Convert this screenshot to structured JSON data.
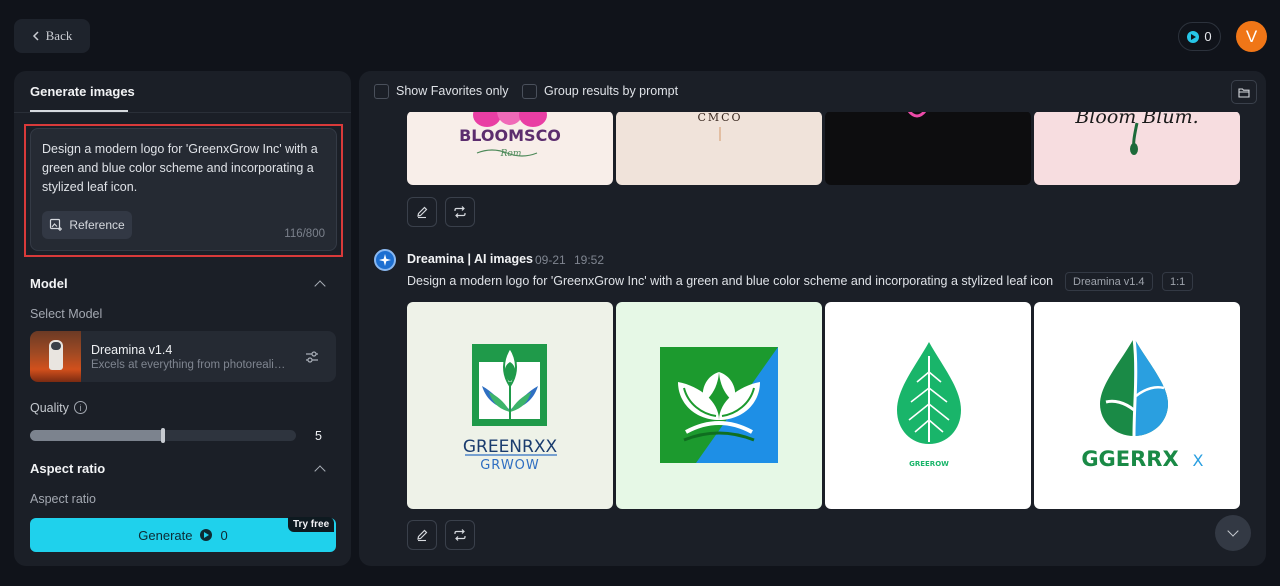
{
  "header": {
    "back_label": "Back",
    "credits": "0",
    "avatar_letter": "V"
  },
  "sidebar": {
    "tab_label": "Generate images",
    "prompt_text": "Design a modern logo for 'GreenxGrow Inc' with a green and blue color scheme and incorporating a stylized leaf icon.",
    "reference_label": "Reference",
    "char_count": "116/800",
    "model_section_title": "Model",
    "select_model_label": "Select Model",
    "model_name": "Dreamina v1.4",
    "model_description": "Excels at everything from photorealism to painterly styles",
    "quality_label": "Quality",
    "quality_value": "5",
    "quality_fraction": 0.5,
    "aspect_section_title": "Aspect ratio",
    "aspect_label": "Aspect ratio",
    "generate_label": "Generate",
    "generate_cost": "0",
    "try_free_label": "Try free"
  },
  "results": {
    "show_favorites_label": "Show Favorites only",
    "group_by_prompt_label": "Group results by prompt",
    "row1_texts": [
      "BLOOMSCO",
      "Rom",
      "CMCO",
      "Bloom Blum."
    ],
    "message": {
      "author": "Dreamina | AI images",
      "date": "09-21",
      "time": "19:52",
      "prompt": "Design a modern logo for 'GreenxGrow Inc' with a green and blue color scheme and incorporating a stylized leaf icon",
      "model_tag": "Dreamina v1.4",
      "ratio_tag": "1:1"
    },
    "row2_texts": [
      "GREENRXX",
      "GRWOW",
      "GREEROW",
      "GGERRX",
      "X"
    ]
  },
  "colors": {
    "accent": "#1fd1ec",
    "highlight_border": "#d93a3a",
    "avatar": "#f07617"
  }
}
